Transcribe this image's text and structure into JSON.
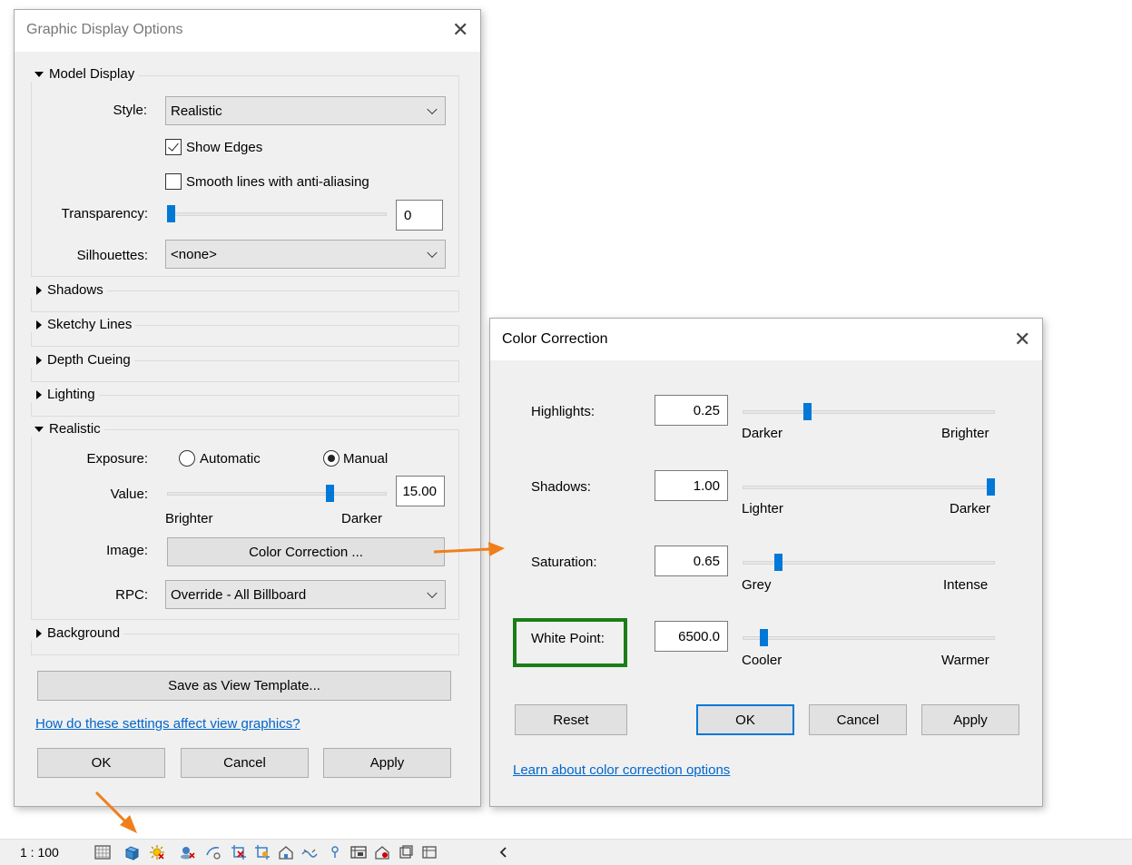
{
  "gdo": {
    "title": "Graphic Display Options",
    "model_display": {
      "header": "Model Display",
      "style_label": "Style:",
      "style_value": "Realistic",
      "show_edges_label": "Show Edges",
      "show_edges_checked": true,
      "smooth_lines_label": "Smooth lines with anti-aliasing",
      "smooth_lines_checked": false,
      "transparency_label": "Transparency:",
      "transparency_value": "0",
      "silhouettes_label": "Silhouettes:",
      "silhouettes_value": "<none>"
    },
    "sections": {
      "shadows": "Shadows",
      "sketchy": "Sketchy Lines",
      "depth": "Depth Cueing",
      "lighting": "Lighting",
      "realistic": "Realistic",
      "background": "Background"
    },
    "realistic": {
      "exposure_label": "Exposure:",
      "automatic_label": "Automatic",
      "manual_label": "Manual",
      "exposure_selected": "Manual",
      "value_label": "Value:",
      "value": "15.00",
      "value_level": 0.75,
      "brighter": "Brighter",
      "darker": "Darker",
      "image_label": "Image:",
      "color_correction_button": "Color Correction ...",
      "rpc_label": "RPC:",
      "rpc_value": "Override - All Billboard"
    },
    "save_template_button": "Save as View Template...",
    "help_link": "How do these settings affect view graphics?",
    "ok": "OK",
    "cancel": "Cancel",
    "apply": "Apply"
  },
  "cc": {
    "title": "Color Correction",
    "highlights": {
      "label": "Highlights:",
      "value": "0.25",
      "low": "Darker",
      "high": "Brighter",
      "level": 0.25
    },
    "shadows": {
      "label": "Shadows:",
      "value": "1.00",
      "low": "Lighter",
      "high": "Darker",
      "level": 1.0
    },
    "saturation": {
      "label": "Saturation:",
      "value": "0.65",
      "low": "Grey",
      "high": "Intense",
      "level": 0.13
    },
    "white_point": {
      "label": "White Point:",
      "value": "6500.0",
      "low": "Cooler",
      "high": "Warmer",
      "level": 0.07
    },
    "reset": "Reset",
    "ok": "OK",
    "cancel": "Cancel",
    "apply": "Apply",
    "learn_link": "Learn about color correction options"
  },
  "statusbar": {
    "scale": "1 : 100",
    "icons": [
      "detail-level-icon",
      "visual-style-icon",
      "sun-path-icon",
      "shadows-icon",
      "crop-view-icon",
      "show-crop-icon",
      "unlock-3d-icon",
      "temporary-hide-icon",
      "reveal-hidden-icon",
      "worksharing-icon",
      "temporary-view-icon",
      "analytical-model-icon",
      "highlight-displacement-icon",
      "reveal-constraints-icon",
      "collapse-icon"
    ]
  },
  "colors": {
    "accent": "#0078d7",
    "highlight_box": "#1b7d17",
    "arrow": "#f07f1b",
    "link": "#0066cc"
  }
}
